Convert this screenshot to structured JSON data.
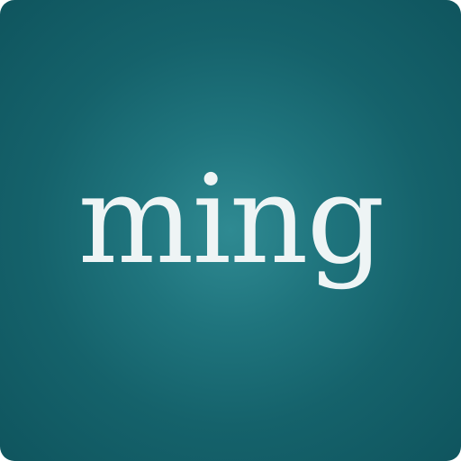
{
  "logo": {
    "text": "ming",
    "text_color": "#eef4f5",
    "background_center_color": "#2f8a92",
    "background_edge_color": "#0f555e"
  }
}
